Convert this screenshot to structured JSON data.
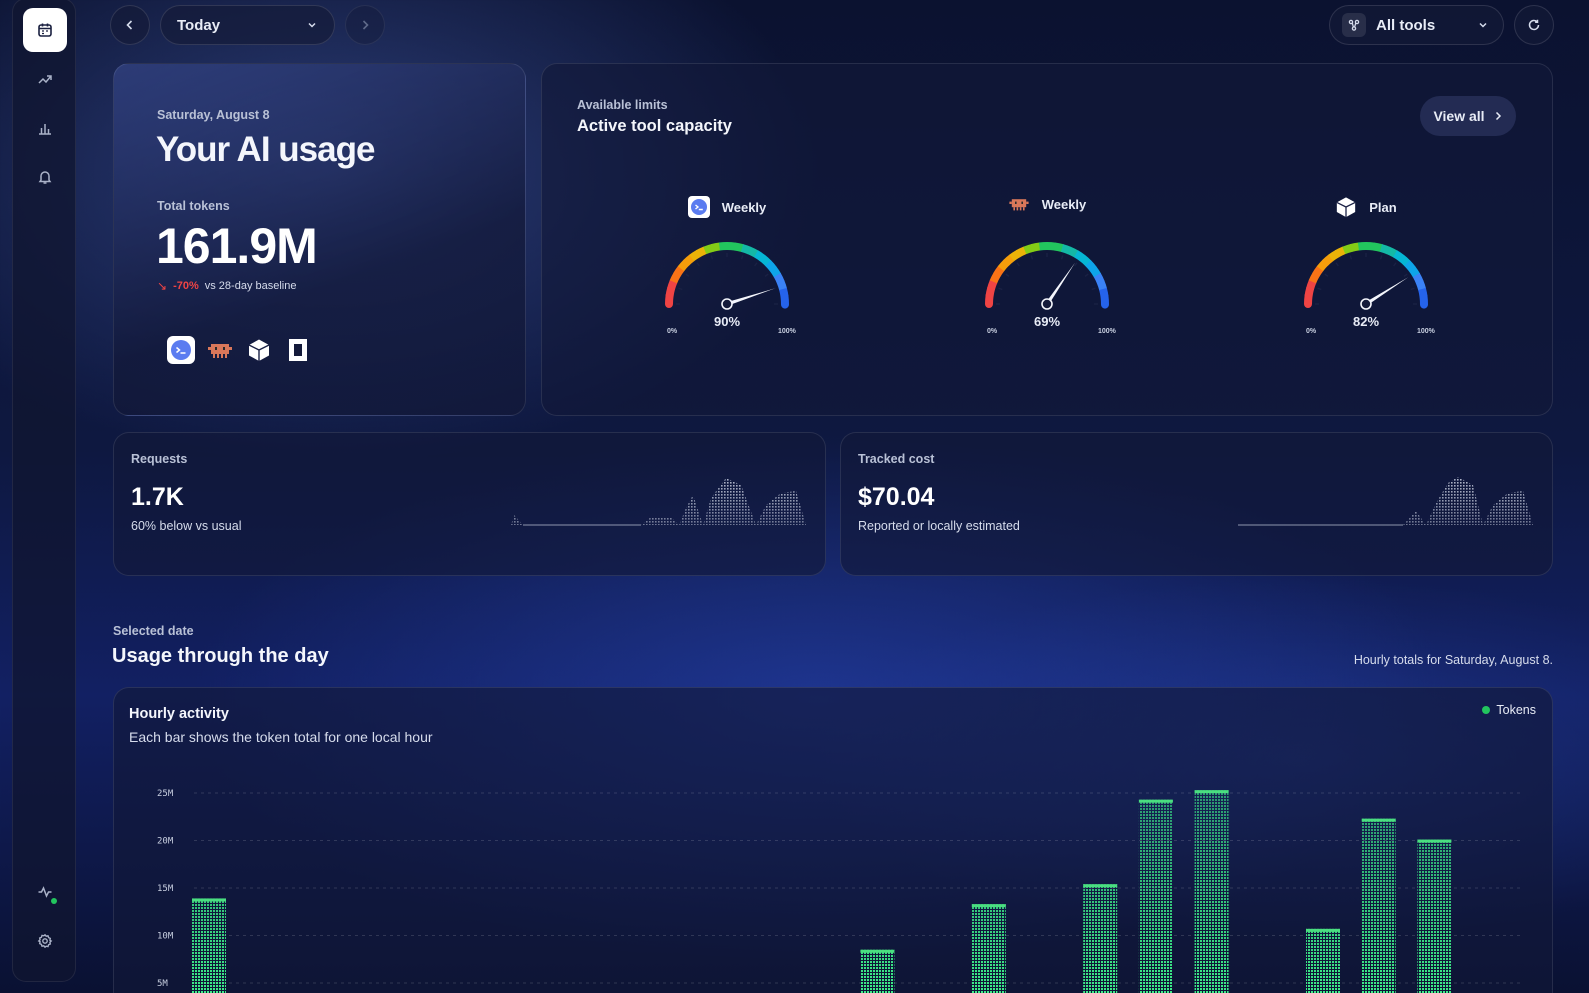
{
  "topbar": {
    "date_select": "Today",
    "tools_select": "All tools"
  },
  "usage_card": {
    "date": "Saturday, August 8",
    "title": "Your AI usage",
    "tokens_label": "Total tokens",
    "tokens_value": "161.9M",
    "delta": "-70%",
    "delta_suffix": "vs 28-day baseline",
    "delta_color": "#ef4444"
  },
  "limits_card": {
    "eyebrow": "Available limits",
    "title": "Active tool capacity",
    "view_all": "View all",
    "gauges": [
      {
        "label": "Weekly",
        "value": 90,
        "value_text": "90%",
        "min": "0%",
        "max": "100%",
        "icon": "terminal-app-icon"
      },
      {
        "label": "Weekly",
        "value": 69,
        "value_text": "69%",
        "min": "0%",
        "max": "100%",
        "icon": "robot-app-icon"
      },
      {
        "label": "Plan",
        "value": 82,
        "value_text": "82%",
        "min": "0%",
        "max": "100%",
        "icon": "cube-app-icon"
      }
    ]
  },
  "requests_card": {
    "label": "Requests",
    "value": "1.7K",
    "sub": "60% below vs usual"
  },
  "cost_card": {
    "label": "Tracked cost",
    "value": "$70.04",
    "sub": "Reported or locally estimated"
  },
  "section": {
    "eyebrow": "Selected date",
    "title": "Usage through the day",
    "note": "Hourly totals for Saturday, August 8."
  },
  "chart_data": {
    "type": "bar",
    "title": "Hourly activity",
    "subtitle": "Each bar shows the token total for one local hour",
    "legend": [
      "Tokens"
    ],
    "legend_color": "#22c55e",
    "y_ticks": [
      "25M",
      "20M",
      "15M",
      "10M",
      "5M"
    ],
    "ylim": [
      0,
      25
    ],
    "unit": "M",
    "bars": [
      {
        "slot": 0,
        "value": 13.9
      },
      {
        "slot": 12,
        "value": 8.5
      },
      {
        "slot": 14,
        "value": 13.3
      },
      {
        "slot": 16,
        "value": 15.4
      },
      {
        "slot": 17,
        "value": 24.3
      },
      {
        "slot": 18,
        "value": 25.3
      },
      {
        "slot": 20,
        "value": 10.7
      },
      {
        "slot": 21,
        "value": 22.3
      },
      {
        "slot": 22,
        "value": 20.1
      }
    ]
  }
}
